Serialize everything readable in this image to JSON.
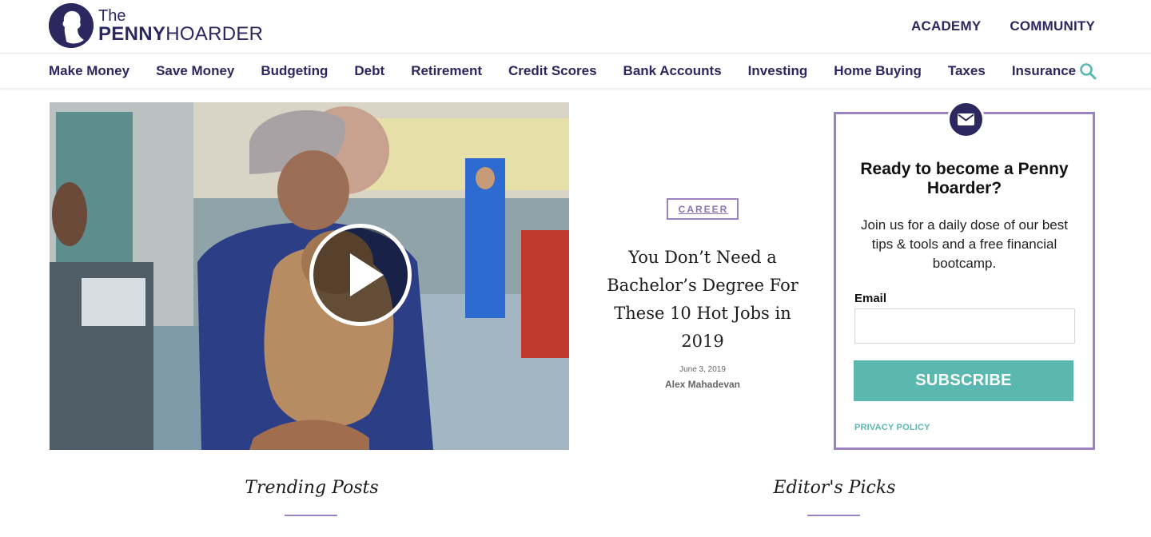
{
  "header": {
    "logo_the": "The",
    "logo_penny": "PENNY",
    "logo_hoarder": "HOARDER",
    "top_links": [
      "ACADEMY",
      "COMMUNITY"
    ]
  },
  "nav": {
    "items": [
      "Make Money",
      "Save Money",
      "Budgeting",
      "Debt",
      "Retirement",
      "Credit Scores",
      "Bank Accounts",
      "Investing",
      "Home Buying",
      "Taxes",
      "Insurance"
    ],
    "search_icon": "search-icon"
  },
  "featured": {
    "category": "CAREER",
    "title": "You Don’t Need a Bachelor’s Degree For These 10 Hot Jobs in 2019",
    "date": "June 3, 2019",
    "author": "Alex Mahadevan"
  },
  "signup": {
    "title": "Ready to become a Penny Hoarder?",
    "description": "Join us for a daily dose of our best tips & tools and a free financial bootcamp.",
    "email_label": "Email",
    "email_value": "",
    "email_placeholder": "",
    "subscribe_label": "SUBSCRIBE",
    "privacy_label": "PRIVACY POLICY"
  },
  "sections": {
    "trending": "Trending Posts",
    "editors": "Editor's Picks"
  },
  "colors": {
    "brand_navy": "#2d2760",
    "accent_purple": "#9c82c3",
    "accent_teal": "#5bb8b0"
  }
}
